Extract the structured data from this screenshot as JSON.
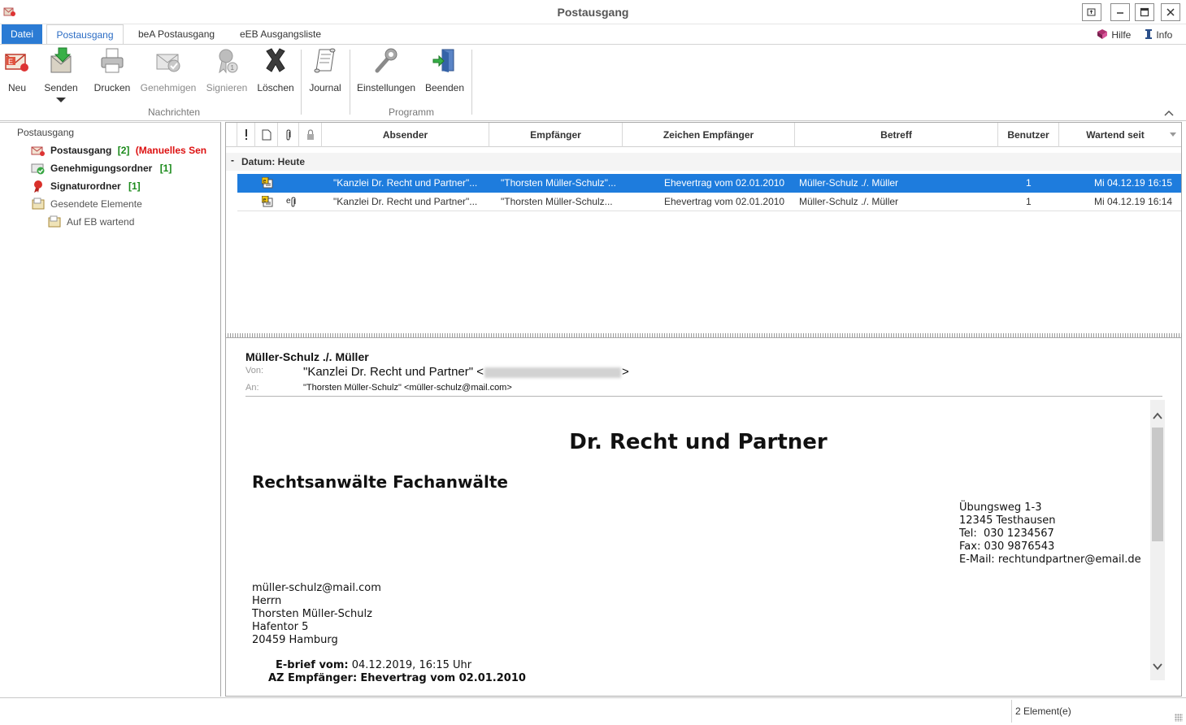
{
  "window": {
    "title": "Postausgang"
  },
  "ribbon_tabs": [
    {
      "label": "Datei"
    },
    {
      "label": "Postausgang"
    },
    {
      "label": "beA Postausgang"
    },
    {
      "label": "eEB Ausgangsliste"
    }
  ],
  "ribbon_links": {
    "help": "Hilfe",
    "info": "Info"
  },
  "ribbon_buttons": {
    "neu": "Neu",
    "senden": "Senden",
    "drucken": "Drucken",
    "genehmigen": "Genehmigen",
    "signieren": "Signieren",
    "loeschen": "Löschen",
    "journal": "Journal",
    "einstellungen": "Einstellungen",
    "beenden": "Beenden"
  },
  "ribbon_groups": {
    "nachrichten": "Nachrichten",
    "programm": "Programm"
  },
  "tree": {
    "root": "Postausgang",
    "items": [
      {
        "label": "Postausgang",
        "count": "[2]",
        "extra": "(Manuelles Sen"
      },
      {
        "label": "Genehmigungsordner",
        "count": "[1]"
      },
      {
        "label": "Signaturordner",
        "count": "[1]"
      },
      {
        "label": "Gesendete Elemente"
      },
      {
        "label": "Auf EB wartend"
      }
    ]
  },
  "list": {
    "columns": [
      "Absender",
      "Empfänger",
      "Zeichen Empfänger",
      "Betreff",
      "Benutzer",
      "Wartend seit"
    ],
    "group_label": "Datum: Heute",
    "group_toggle": "-",
    "rows": [
      {
        "sender": "\"Kanzlei Dr. Recht und Partner\"...",
        "recipient": "\"Thorsten Müller-Schulz\"...",
        "ref": "Ehevertrag vom 02.01.2010",
        "subject": "Müller-Schulz ./. Müller",
        "user": "1",
        "waiting": "Mi 04.12.19 16:15",
        "selected": true,
        "attachment": false
      },
      {
        "sender": "\"Kanzlei Dr. Recht und Partner\"...",
        "recipient": "\"Thorsten Müller-Schulz...",
        "ref": "Ehevertrag vom 02.01.2010",
        "subject": "Müller-Schulz ./. Müller",
        "user": "1",
        "waiting": "Mi 04.12.19 16:14",
        "selected": false,
        "attachment": true
      }
    ]
  },
  "preview": {
    "subject": "Müller-Schulz ./. Müller",
    "from_label": "Von:",
    "from_name": "\"Kanzlei Dr. Recht und Partner\" <",
    "from_end": ">",
    "to_label": "An:",
    "to": "\"Thorsten Müller-Schulz\" <müller-schulz@mail.com>",
    "document": {
      "title": "Dr. Recht und Partner",
      "subtitle": "Rechtsanwälte Fachanwälte",
      "address_lines": [
        "Übungsweg 1-3",
        "12345 Testhausen",
        "Tel:  030 1234567",
        "Fax: 030 9876543",
        "E-Mail: rechtundpartner@email.de"
      ],
      "recipient_lines": [
        "müller-schulz@mail.com",
        "Herrn",
        "Thorsten Müller-Schulz",
        "Hafentor 5",
        "20459 Hamburg"
      ],
      "ebrief_label": "E-brief vom:",
      "ebrief_value": "04.12.2019, 16:15 Uhr",
      "az_label": "AZ Empfänger:",
      "az_value": "Ehevertrag vom 02.01.2010"
    }
  },
  "status": {
    "count": "2 Element(e)"
  }
}
